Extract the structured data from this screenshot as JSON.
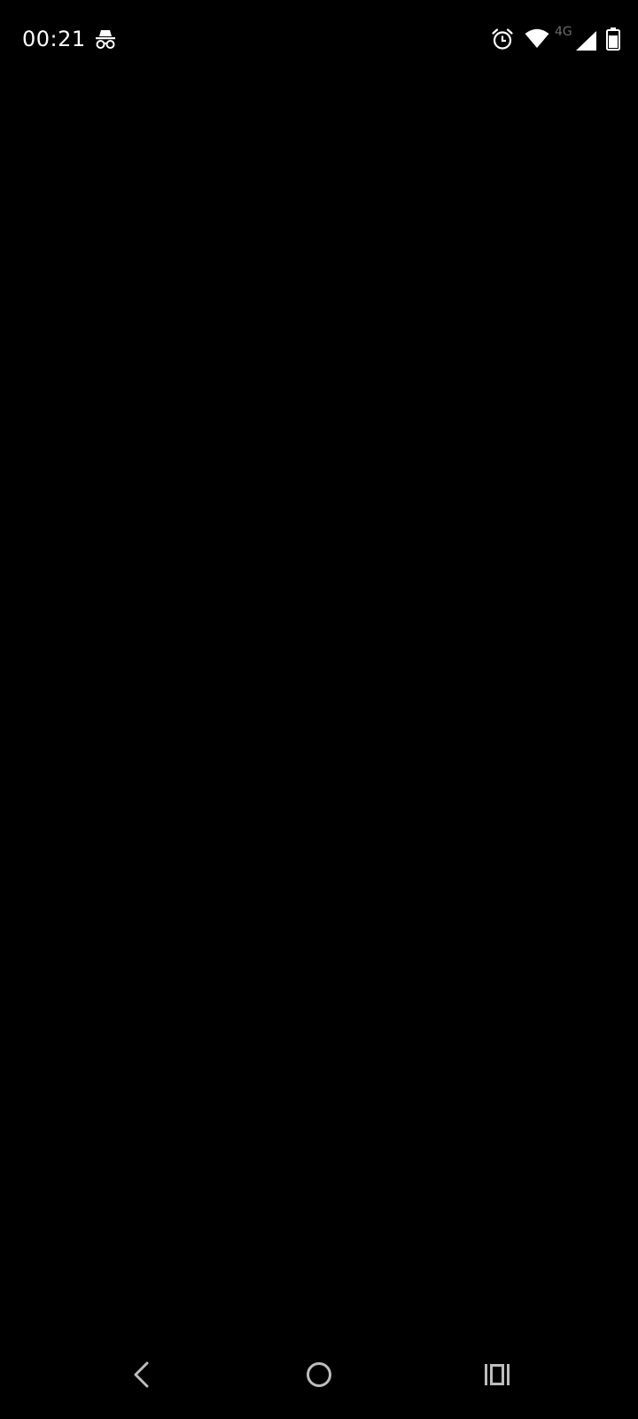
{
  "status_bar": {
    "time": "00:21",
    "network_type": "4G",
    "icons": {
      "incognito": "incognito-icon",
      "alarm": "alarm-icon",
      "wifi": "wifi-icon",
      "signal": "cell-signal-icon",
      "battery": "battery-icon"
    }
  },
  "navigation_bar": {
    "back": "back-icon",
    "home": "home-icon",
    "recents": "recents-icon"
  },
  "colors": {
    "background": "#000000",
    "status_text": "#ffffff",
    "network_type_text": "#6b6b6b",
    "nav_icon": "#bdbdbd"
  }
}
